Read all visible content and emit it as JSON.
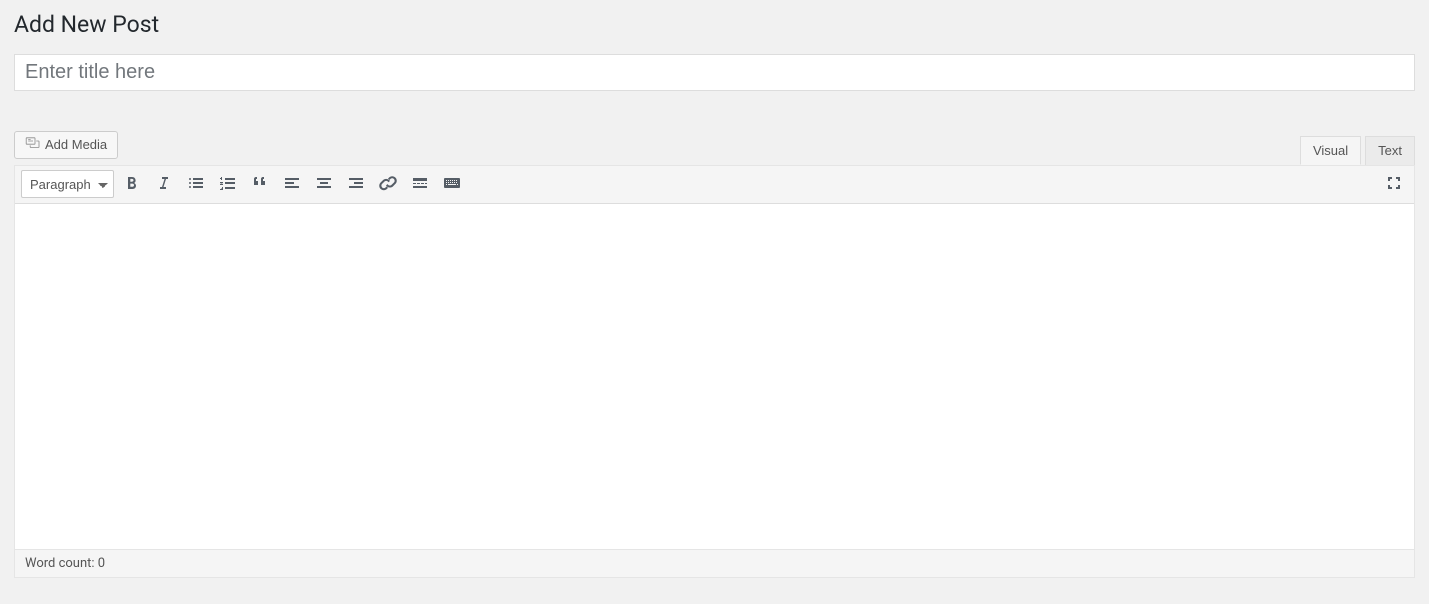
{
  "page": {
    "title": "Add New Post"
  },
  "title_field": {
    "placeholder": "Enter title here",
    "value": ""
  },
  "media_button": {
    "label": "Add Media"
  },
  "tabs": {
    "visual": "Visual",
    "text": "Text",
    "active": "visual"
  },
  "toolbar": {
    "format_selected": "Paragraph"
  },
  "status": {
    "word_count_label": "Word count: ",
    "word_count": 0
  }
}
